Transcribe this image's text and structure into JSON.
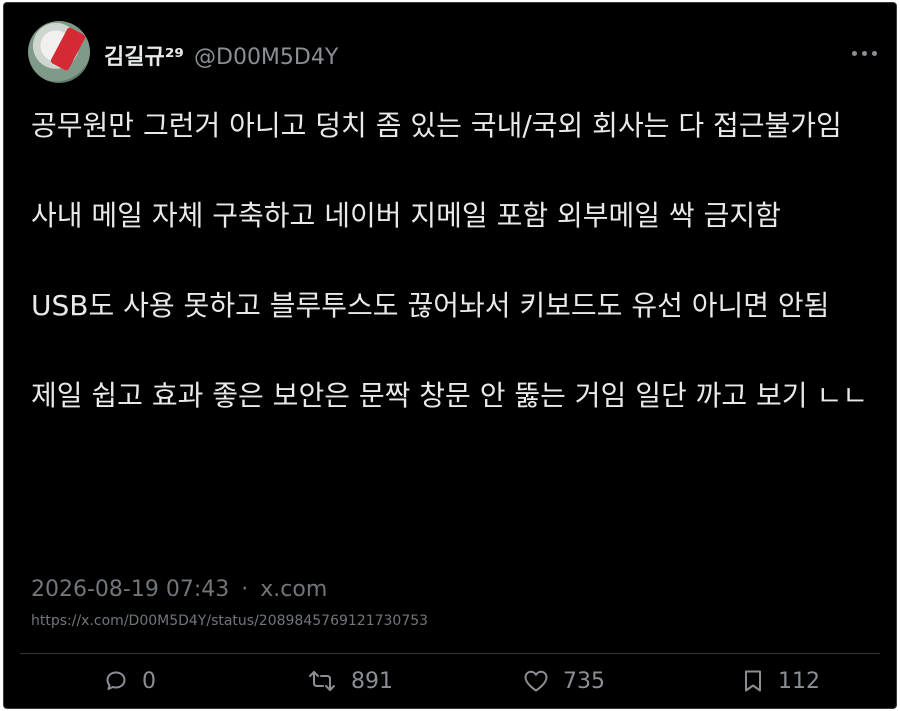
{
  "tweet": {
    "display_name": "김길규²⁹",
    "handle": "@D00M5D4Y",
    "paragraphs": [
      "공무원만 그런거 아니고 덩치 좀 있는 국내/국외 회사는 다 접근불가임",
      "사내 메일 자체 구축하고 네이버 지메일 포함 외부메일 싹 금지함",
      "USB도 사용 못하고 블루투스도 끊어놔서 키보드도 유선 아니면 안됨",
      "제일 쉽고 효과 좋은 보안은 문짝 창문 안 뚫는 거임 일단 까고 보기 ㄴㄴ"
    ],
    "timestamp": "2026-08-19 07:43",
    "meta_separator": "·",
    "source": "x.com",
    "url": "https://x.com/D00M5D4Y/status/2089845769121730753"
  },
  "actions": {
    "reply": {
      "icon": "reply-icon",
      "count": "0"
    },
    "retweet": {
      "icon": "retweet-icon",
      "count": "891"
    },
    "like": {
      "icon": "heart-icon",
      "count": "735"
    },
    "bookmark": {
      "icon": "bookmark-icon",
      "count": "112"
    }
  },
  "colors": {
    "background": "#000000",
    "text_primary": "#e7e9ea",
    "text_secondary": "#71767b",
    "avatar_accent": "#d42a34"
  }
}
